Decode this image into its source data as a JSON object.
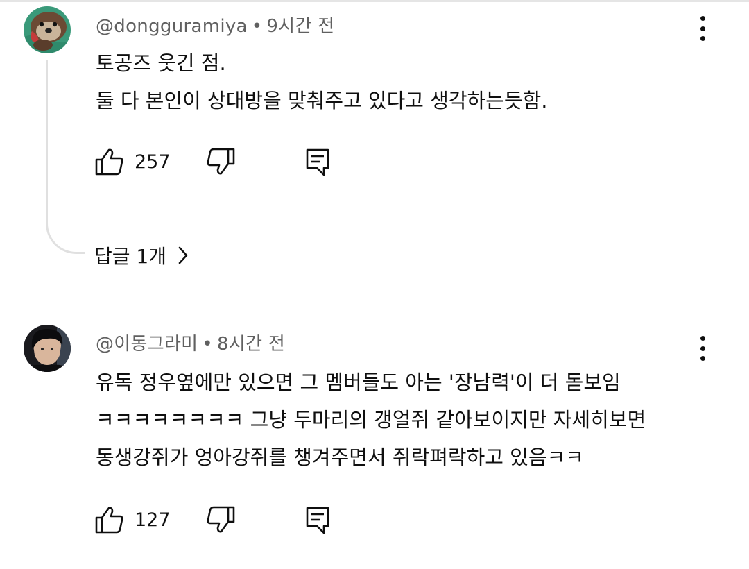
{
  "comments": [
    {
      "username": "@dongguramiya",
      "time": "9시간 전",
      "avatar_icon": "sea-otter-avatar",
      "lines": [
        "토공즈 웃긴 점.",
        "둘 다 본인이 상대방을 맞춰주고 있다고 생각하는듯함."
      ],
      "likes": "257",
      "replies_label": "답글 1개"
    },
    {
      "username": "@이동그라미",
      "time": "8시간 전",
      "avatar_icon": "person-photo-avatar",
      "lines": [
        "유독 정우옆에만 있으면 그 멤버들도 아는 '장남력'이 더 돋보임",
        "ㅋㅋㅋㅋㅋㅋㅋㅋ 그냥 두마리의 갱얼쥐 같아보이지만 자세히보면",
        "동생강쥐가 엉아강쥐를 챙겨주면서 쥐락펴락하고 있음ㅋㅋ"
      ],
      "likes": "127"
    }
  ],
  "separator": "•",
  "icons": {
    "like": "thumbs-up-icon",
    "dislike": "thumbs-down-icon",
    "reply": "reply-comment-icon",
    "more": "more-vert-icon",
    "chevron": "chevron-right-icon"
  },
  "colors": {
    "text": "#0f0f0f",
    "meta": "#606060",
    "thread_line": "#e0e0e0"
  }
}
